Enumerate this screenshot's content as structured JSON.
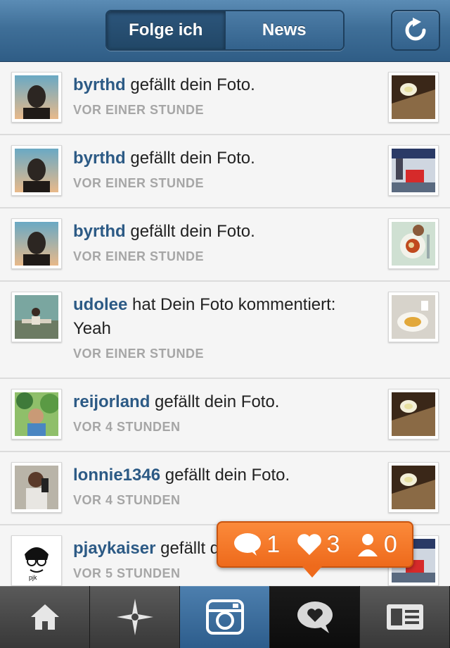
{
  "header": {
    "tabs": [
      {
        "label": "Folge ich",
        "active": true
      },
      {
        "label": "News",
        "active": false
      }
    ],
    "refresh_icon": "refresh-icon"
  },
  "notifications": [
    {
      "user": "byrthd",
      "action": "gefällt dein Foto.",
      "time": "VOR EINER STUNDE"
    },
    {
      "user": "byrthd",
      "action": "gefällt dein Foto.",
      "time": "VOR EINER STUNDE"
    },
    {
      "user": "byrthd",
      "action": "gefällt dein Foto.",
      "time": "VOR EINER STUNDE"
    },
    {
      "user": "udolee",
      "action": "hat Dein Foto kommentiert: Yeah",
      "time": "VOR EINER STUNDE"
    },
    {
      "user": "reijorland",
      "action": "gefällt dein Foto.",
      "time": "VOR 4 STUNDEN"
    },
    {
      "user": "lonnie1346",
      "action": "gefällt dein Foto.",
      "time": "VOR 4 STUNDEN"
    },
    {
      "user": "pjaykaiser",
      "action": "gefällt dein Foto.",
      "time": "VOR 5 STUNDEN"
    }
  ],
  "badge": {
    "comments": "1",
    "likes": "3",
    "followers": "0"
  },
  "tabbar": {
    "items": [
      "home-icon",
      "explore-icon",
      "camera-icon",
      "news-icon",
      "profile-icon"
    ],
    "active": "news-icon"
  },
  "colors": {
    "header_blue": "#3f6f98",
    "username_blue": "#2c5a85",
    "badge_orange": "#f47a2a"
  }
}
